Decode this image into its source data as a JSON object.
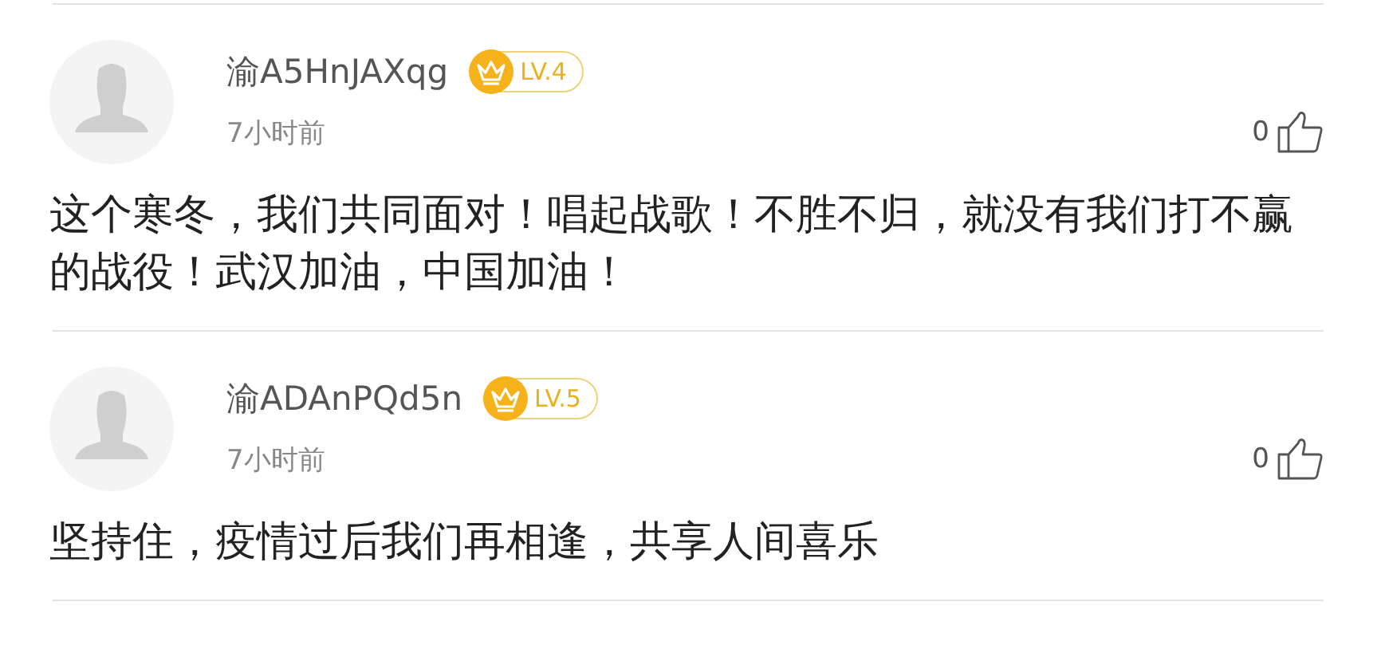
{
  "comments": [
    {
      "username": "渝A5HnJAXqg",
      "level": "LV.4",
      "time": "7小时前",
      "likes": "0",
      "text": "这个寒冬，我们共同面对！唱起战歌！不胜不归，就没有我们打不赢的战役！武汉加油，中国加油！"
    },
    {
      "username": "渝ADAnPQd5n",
      "level": "LV.5",
      "time": "7小时前",
      "likes": "0",
      "text": "坚持住，疫情过后我们再相逢，共享人间喜乐"
    }
  ]
}
